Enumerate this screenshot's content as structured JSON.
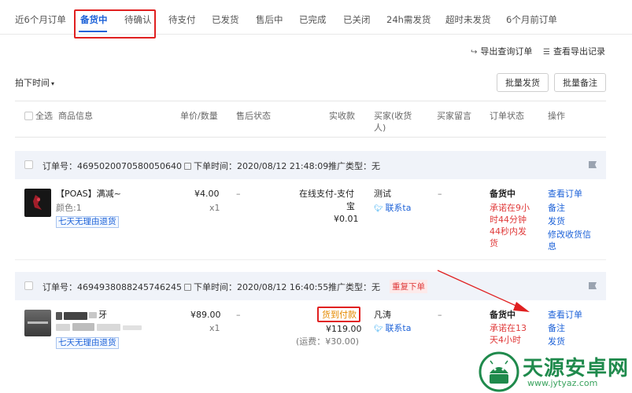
{
  "tabs": [
    {
      "label": "近6个月订单"
    },
    {
      "label": "备货中"
    },
    {
      "label": "待确认"
    },
    {
      "label": "待支付"
    },
    {
      "label": "已发货"
    },
    {
      "label": "售后中"
    },
    {
      "label": "已完成"
    },
    {
      "label": "已关闭"
    },
    {
      "label": "24h需发货"
    },
    {
      "label": "超时未发货"
    },
    {
      "label": "6个月前订单"
    }
  ],
  "toolbar": {
    "export_orders": "导出查询订单",
    "view_exports": "查看导出记录",
    "sort_label": "拍下时间",
    "batch_ship": "批量发货",
    "batch_note": "批量备注"
  },
  "columns": {
    "select_all": "全选",
    "product": "商品信息",
    "price_qty": "单价/数量",
    "after_sale": "售后状态",
    "paid": "实收款",
    "buyer": "买家(收货人)",
    "message": "买家留言",
    "status": "订单状态",
    "actions": "操作"
  },
  "orders": [
    {
      "order_no_label": "订单号：4695020070580050640",
      "order_time_label": "下单时间：2020/08/12 21:48:09",
      "promo_label": "推广类型：无",
      "product_title": "【POAS】满减~",
      "product_spec": "颜色:1",
      "return_badge": "七天无理由退货",
      "price": "¥4.00",
      "qty": "x1",
      "after_sale": "–",
      "pay_line1": "在线支付-支付",
      "pay_line2": "宝",
      "paid_amount": "¥0.01",
      "buyer_name": "测试",
      "contact": "联系ta",
      "message": "–",
      "status": "备货中",
      "promise_lines": [
        "承诺在9小",
        "时44分钟",
        "44秒内发",
        "货"
      ],
      "actions": [
        "查看订单",
        "备注",
        "发货",
        "修改收货信",
        "息"
      ]
    },
    {
      "order_no_label": "订单号：4694938088245746245",
      "order_time_label": "下单时间：2020/08/12 16:40:55",
      "promo_label": "推广类型：无",
      "repeat_tag": "重复下单",
      "product_title_fragment": "牙",
      "return_badge": "七天无理由退货",
      "price": "¥89.00",
      "qty": "x1",
      "after_sale": "–",
      "cod_label": "货到付款",
      "paid_amount": "¥119.00",
      "shipping": "(运费：¥30.00)",
      "buyer_name": "凡涛",
      "contact": "联系ta",
      "message": "–",
      "status": "备货中",
      "promise_lines": [
        "承诺在13",
        "天4小时"
      ],
      "actions": [
        "查看订单",
        "备注",
        "发货"
      ]
    }
  ],
  "watermark": {
    "name": "天源安卓网",
    "url": "www.jytyaz.com"
  },
  "colors": {
    "accent": "#1d62d8",
    "highlight_box": "#e02020",
    "warning": "#e03b3b",
    "order_bar": "#f0f3f9"
  }
}
